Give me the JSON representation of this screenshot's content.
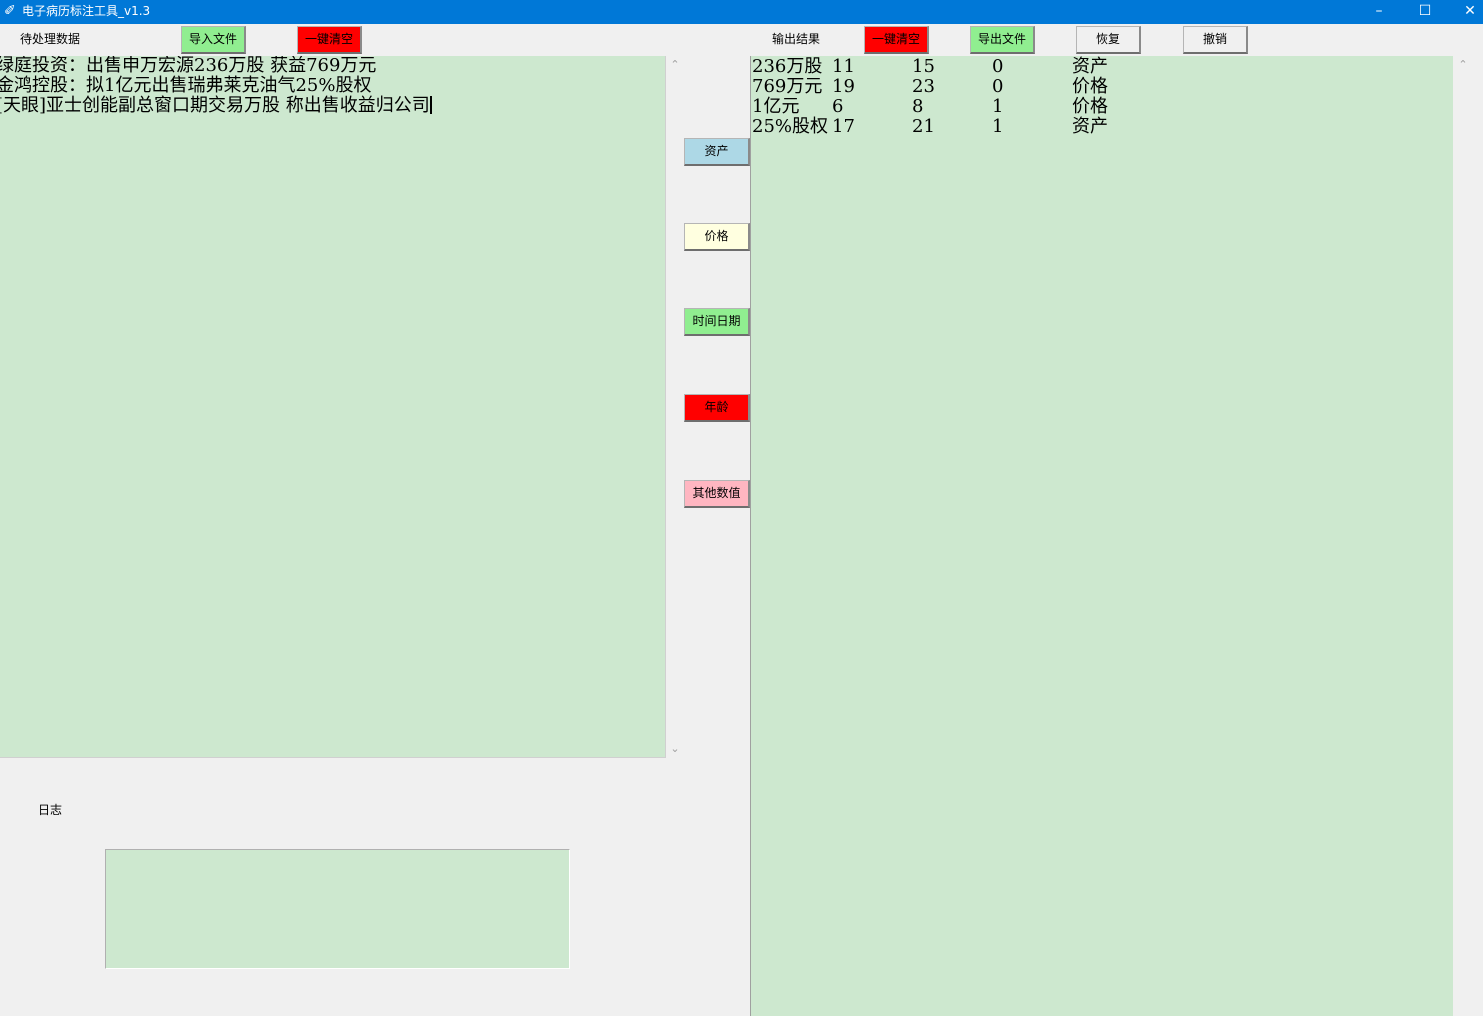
{
  "window": {
    "title": "电子病历标注工具_v1.3",
    "icon": "feather-icon",
    "minimize": "–",
    "maximize": "☐",
    "close": "✕"
  },
  "toolbar_left": {
    "label": "待处理数据",
    "import_button": "导入文件",
    "clear_button": "一键清空"
  },
  "toolbar_right": {
    "label": "输出结果",
    "clear_button": "一键清空",
    "export_button": "导出文件",
    "restore_button": "恢复",
    "undo_button": "撤销"
  },
  "input_lines": [
    "绿庭投资：出售申万宏源236万股 获益769万元",
    "金鸿控股：拟1亿元出售瑞弗莱克油气25%股权",
    "[天眼]亚士创能副总窗口期交易万股 称出售收益归公司"
  ],
  "label_buttons": [
    {
      "label": "资产",
      "color": "#add8e6"
    },
    {
      "label": "价格",
      "color": "#ffffe0"
    },
    {
      "label": "时间日期",
      "color": "#90ee90"
    },
    {
      "label": "年龄",
      "color": "#ff0000"
    },
    {
      "label": "其他数值",
      "color": "#ffb6c1"
    }
  ],
  "output_rows": [
    {
      "text": "236万股",
      "start": "11",
      "end": "15",
      "flag": "0",
      "type": "资产"
    },
    {
      "text": "769万元",
      "start": "19",
      "end": "23",
      "flag": "0",
      "type": "价格"
    },
    {
      "text": "1亿元",
      "start": "6",
      "end": "8",
      "flag": "1",
      "type": "价格"
    },
    {
      "text": "25%股权",
      "start": "17",
      "end": "21",
      "flag": "1",
      "type": "资产"
    }
  ],
  "log": {
    "label": "日志",
    "content": ""
  },
  "colors": {
    "titlebar": "#0078d7",
    "textarea_bg": "#cde8cf",
    "green_button": "#90ee90",
    "red_button": "#ff0000",
    "light_button": "#f0f0f0"
  }
}
